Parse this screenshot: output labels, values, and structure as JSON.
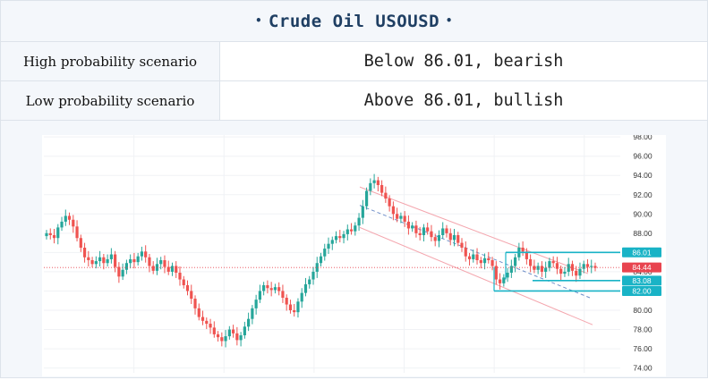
{
  "header": {
    "title": "Crude Oil USOUSD",
    "dot_left": "•",
    "dot_right": "•"
  },
  "scenarios": [
    {
      "label": "High probability scenario",
      "value": "Below 86.01, bearish"
    },
    {
      "label": "Low probability scenario",
      "value": "Above 86.01, bullish"
    }
  ],
  "chart_data": {
    "type": "candlestick",
    "y_ticks": [
      "98.00",
      "96.00",
      "94.00",
      "92.00",
      "90.00",
      "88.00",
      "86.00",
      "84.00",
      "82.00",
      "80.00",
      "78.00",
      "76.00",
      "74.00"
    ],
    "ylim": [
      73.5,
      98.2
    ],
    "levels": [
      {
        "label": "86.01",
        "value": 86.01,
        "color": "#19b3c6"
      },
      {
        "label": "84.44",
        "value": 84.44,
        "color": "#e8444f"
      },
      {
        "label": "83.08",
        "value": 83.08,
        "color": "#19b3c6"
      },
      {
        "label": "82.00",
        "value": 82.0,
        "color": "#19b3c6"
      }
    ],
    "closes": [
      88.0,
      87.8,
      87.5,
      88.6,
      89.2,
      89.8,
      89.4,
      88.7,
      87.5,
      86.5,
      85.5,
      85.2,
      84.8,
      85.1,
      85.5,
      84.9,
      85.3,
      85.8,
      84.5,
      83.5,
      84.2,
      84.9,
      85.3,
      85.0,
      85.6,
      86.1,
      85.5,
      84.6,
      84.1,
      84.8,
      85.2,
      84.5,
      84.0,
      84.6,
      83.9,
      83.2,
      82.6,
      82.0,
      81.2,
      80.2,
      79.3,
      78.9,
      78.6,
      78.2,
      77.5,
      77.2,
      76.8,
      77.3,
      78.0,
      77.6,
      76.9,
      77.4,
      78.3,
      79.1,
      80.2,
      81.1,
      82.0,
      82.6,
      82.3,
      82.1,
      82.4,
      82.0,
      81.3,
      80.6,
      80.0,
      79.8,
      80.9,
      81.8,
      82.7,
      83.2,
      84.0,
      84.9,
      85.6,
      86.4,
      86.9,
      87.3,
      87.7,
      87.5,
      87.9,
      88.4,
      88.2,
      88.8,
      89.6,
      90.8,
      92.4,
      93.2,
      93.5,
      93.0,
      92.2,
      91.6,
      90.8,
      90.0,
      89.5,
      89.8,
      89.2,
      88.5,
      88.8,
      88.0,
      87.8,
      88.6,
      88.2,
      87.6,
      87.2,
      87.8,
      88.5,
      88.0,
      87.3,
      87.8,
      87.0,
      86.5,
      85.6,
      85.3,
      85.8,
      85.2,
      84.9,
      85.4,
      85.2,
      84.6,
      83.2,
      82.8,
      83.4,
      83.9,
      84.6,
      85.5,
      86.5,
      86.1,
      85.3,
      84.6,
      84.2,
      84.6,
      84.0,
      84.4,
      85.1,
      84.9,
      84.3,
      83.8,
      84.0,
      84.8,
      84.1,
      83.6,
      84.3,
      84.8,
      84.5,
      84.6,
      84.4
    ]
  },
  "colors": {
    "up": "#26a69a",
    "down": "#ef5350",
    "accent": "#19b3c6",
    "title": "#1f3f63"
  }
}
